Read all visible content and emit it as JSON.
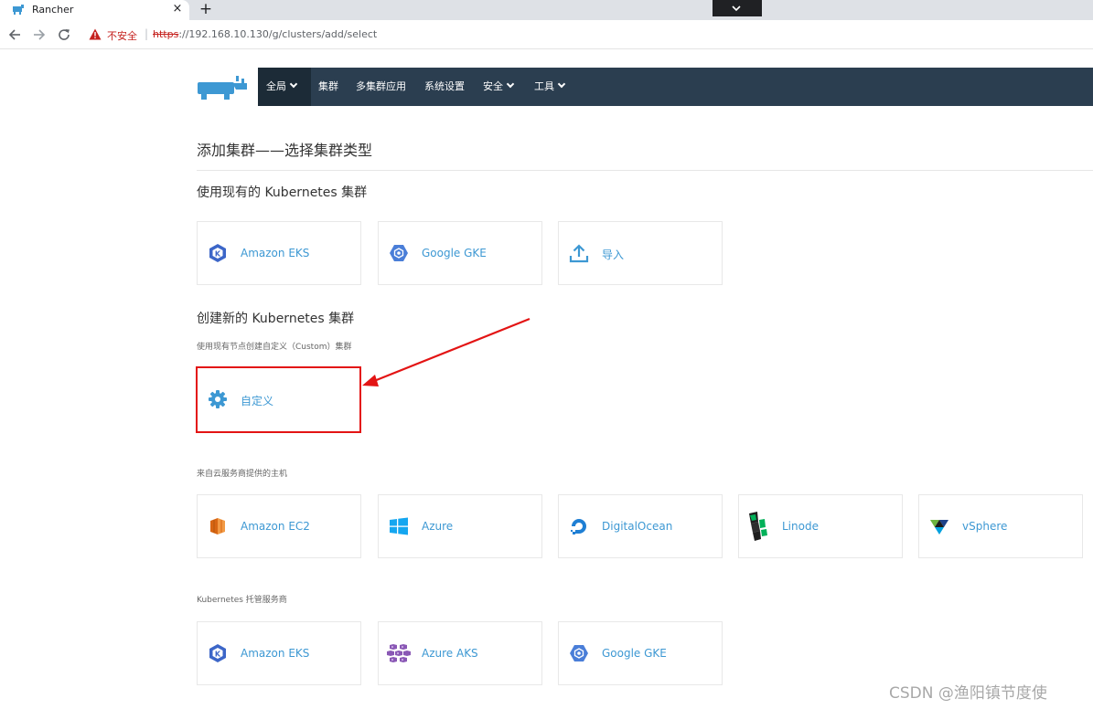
{
  "browser": {
    "tab_title": "Rancher",
    "tab_close": "×",
    "new_tab": "+",
    "security_warning": "不安全",
    "url_protocol": "https",
    "url_rest": "://192.168.10.130/g/clusters/add/select"
  },
  "nav": {
    "items": [
      {
        "label": "全局",
        "has_dropdown": true,
        "active": true
      },
      {
        "label": "集群",
        "has_dropdown": false
      },
      {
        "label": "多集群应用",
        "has_dropdown": false
      },
      {
        "label": "系统设置",
        "has_dropdown": false
      },
      {
        "label": "安全",
        "has_dropdown": true
      },
      {
        "label": "工具",
        "has_dropdown": true
      }
    ]
  },
  "page": {
    "title": "添加集群——选择集群类型"
  },
  "sections": {
    "existing": {
      "heading": "使用现有的 Kubernetes 集群",
      "cards": [
        {
          "label": "Amazon EKS",
          "icon": "amazon-eks-icon"
        },
        {
          "label": "Google GKE",
          "icon": "google-gke-icon"
        },
        {
          "label": "导入",
          "icon": "import-upload-icon"
        }
      ]
    },
    "create": {
      "heading": "创建新的 Kubernetes 集群",
      "sub": "使用现有节点创建自定义（Custom）集群",
      "cards": [
        {
          "label": "自定义",
          "icon": "gear-icon"
        }
      ]
    },
    "cloud": {
      "sub": "来自云服务商提供的主机",
      "cards": [
        {
          "label": "Amazon EC2",
          "icon": "amazon-ec2-icon"
        },
        {
          "label": "Azure",
          "icon": "azure-windows-icon"
        },
        {
          "label": "DigitalOcean",
          "icon": "digitalocean-icon"
        },
        {
          "label": "Linode",
          "icon": "linode-icon"
        },
        {
          "label": "vSphere",
          "icon": "vsphere-icon"
        }
      ]
    },
    "hosted": {
      "sub": "Kubernetes 托管服务商",
      "cards": [
        {
          "label": "Amazon EKS",
          "icon": "amazon-eks-icon"
        },
        {
          "label": "Azure AKS",
          "icon": "azure-aks-icon"
        },
        {
          "label": "Google GKE",
          "icon": "google-gke-icon"
        }
      ]
    }
  },
  "watermark": "CSDN @渔阳镇节度使",
  "colors": {
    "nav_bg": "#2b3e50",
    "nav_active": "#1c2b37",
    "link_blue": "#3d98d3",
    "annotation_red": "#e31414"
  }
}
